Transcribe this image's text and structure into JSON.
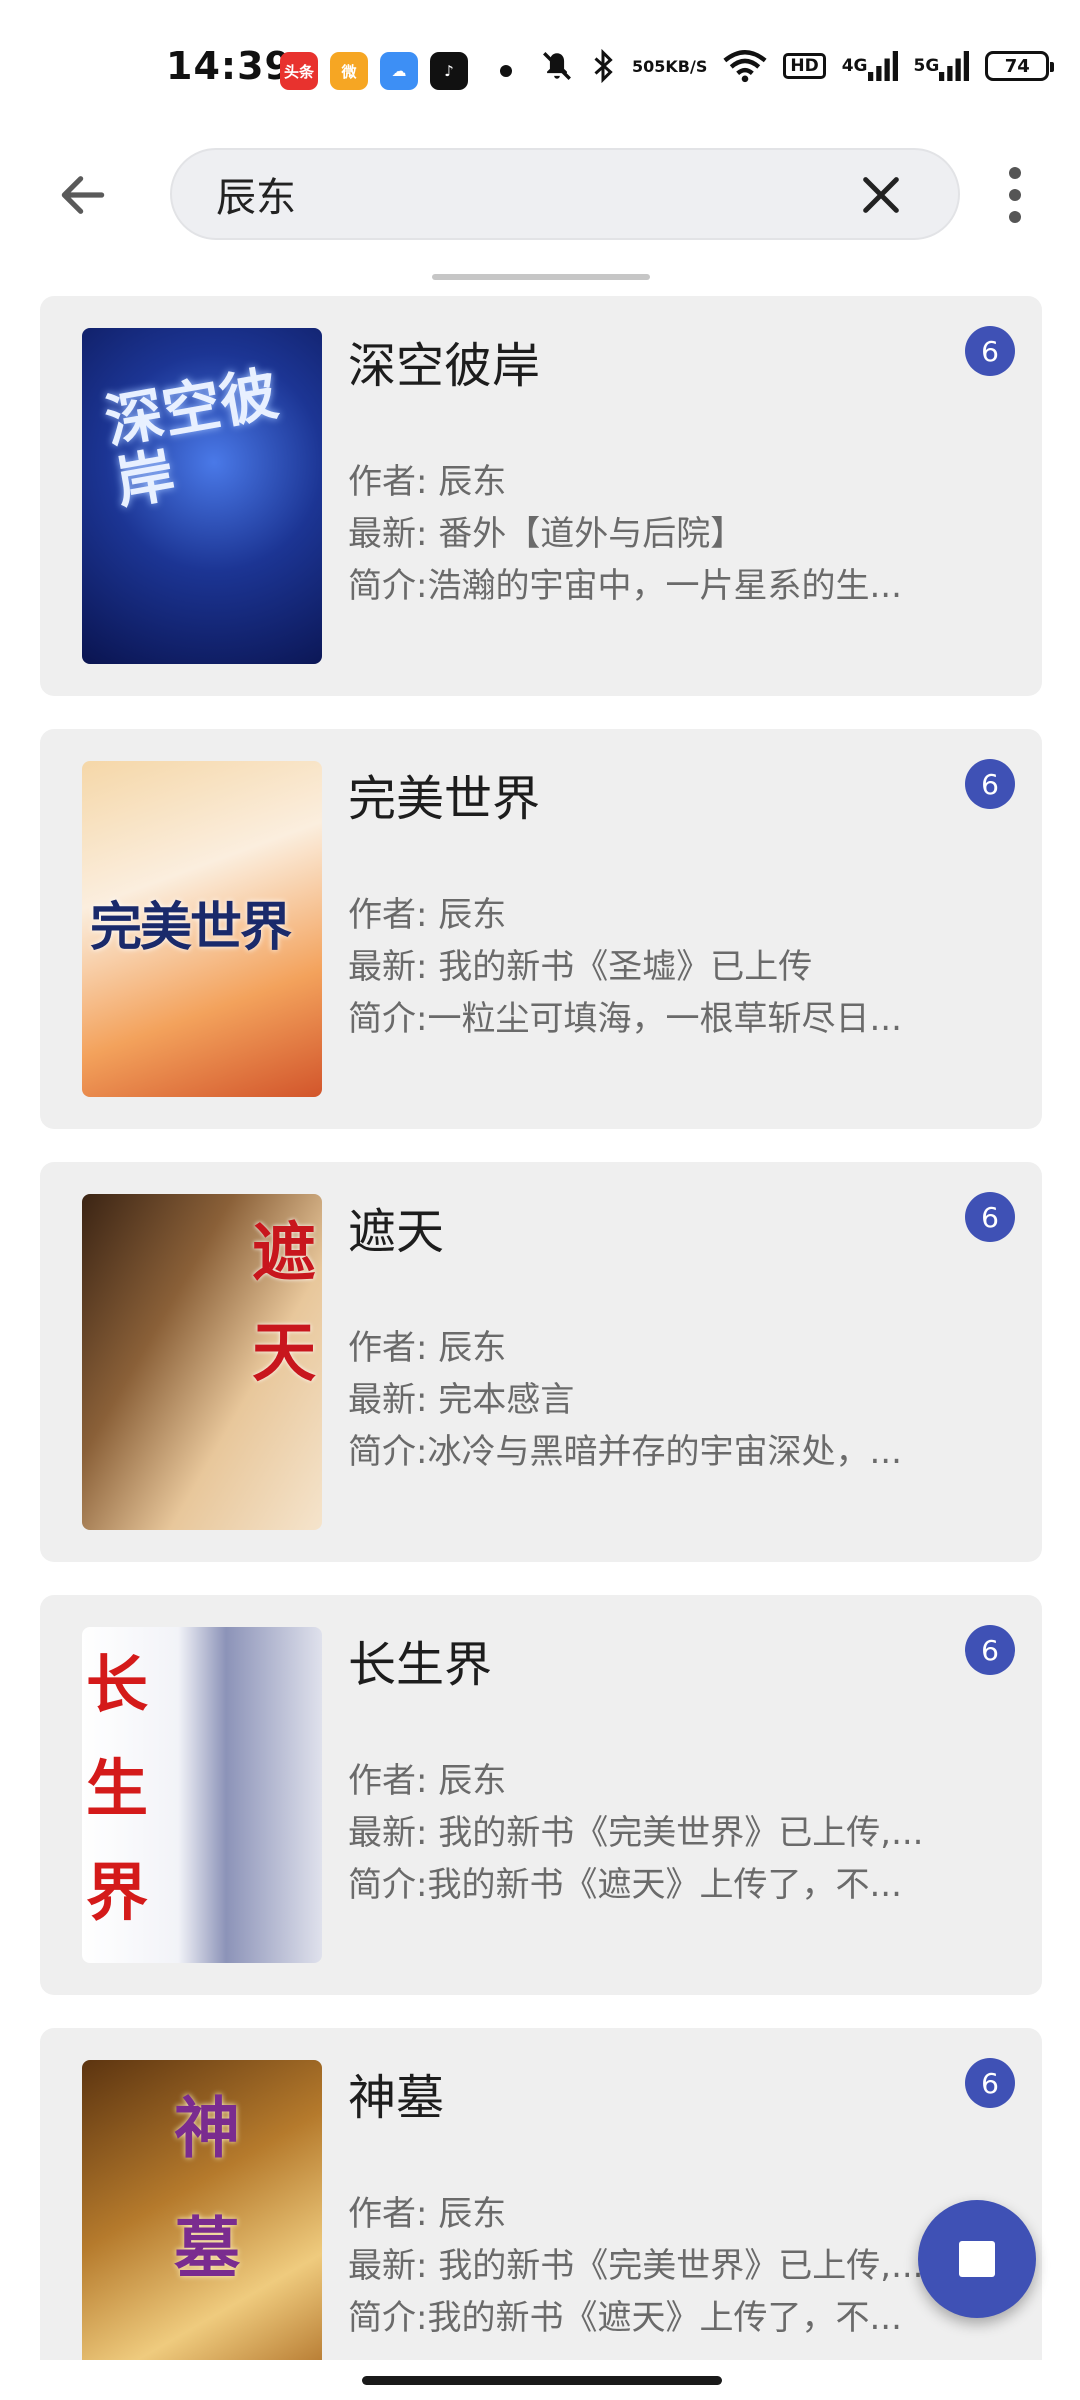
{
  "status_bar": {
    "time": "14:39",
    "app_icons": [
      {
        "name": "toutiao-icon",
        "label": "头条",
        "color": "#e8322e"
      },
      {
        "name": "weibo-icon",
        "label": "微",
        "color": "#f6a623"
      },
      {
        "name": "weather-icon",
        "label": "☁",
        "color": "#3d8ff5"
      },
      {
        "name": "tiktok-icon",
        "label": "♪",
        "color": "#111111"
      }
    ],
    "net_speed_value": "505",
    "net_speed_unit": "KB/S",
    "hd_label": "HD",
    "signal_1_label": "4G",
    "signal_2_label": "5G",
    "battery": "74"
  },
  "search": {
    "query": "辰东",
    "placeholder": ""
  },
  "books": [
    {
      "title": "深空彼岸",
      "author": "作者: 辰东",
      "latest": "最新: 番外【道外与后院】",
      "intro": "简介:浩瀚的宇宙中，一片星系的生...",
      "source_count": "6",
      "cover_text": "深空彼岸",
      "cover_colors": [
        "#0f1f6b",
        "#2a4fc4",
        "#0b1440"
      ]
    },
    {
      "title": "完美世界",
      "author": "作者: 辰东",
      "latest": "最新: 我的新书《圣墟》已上传",
      "intro": "简介:一粒尘可填海，一根草斩尽日...",
      "source_count": "6",
      "cover_text": "完美世界",
      "cover_colors": [
        "#f6a14a",
        "#fde3c0",
        "#d8582d"
      ]
    },
    {
      "title": "遮天",
      "author": "作者: 辰东",
      "latest": "最新: 完本感言",
      "intro": "简介:冰冷与黑暗并存的宇宙深处，...",
      "source_count": "6",
      "cover_text": "遮天",
      "cover_colors": [
        "#5a3b22",
        "#c79a6a",
        "#f2dcc0"
      ]
    },
    {
      "title": "长生界",
      "author": "作者: 辰东",
      "latest": "最新: 我的新书《完美世界》已上传,...",
      "intro": "简介:我的新书《遮天》上传了，不...",
      "source_count": "6",
      "cover_text": "长生界",
      "cover_colors": [
        "#ffffff",
        "#d9dbe8",
        "#9aa0bd"
      ]
    },
    {
      "title": "神墓",
      "author": "作者: 辰东",
      "latest": "最新: 我的新书《完美世界》已上传,...",
      "intro": "简介:我的新书《遮天》上传了，不...",
      "source_count": "6",
      "cover_text": "神墓",
      "cover_colors": [
        "#7a4a14",
        "#d49a3c",
        "#f3d28a"
      ]
    }
  ],
  "colors": {
    "accent": "#3f51b5",
    "card_bg": "#efefef",
    "secondary_text": "#6a6a6a"
  }
}
